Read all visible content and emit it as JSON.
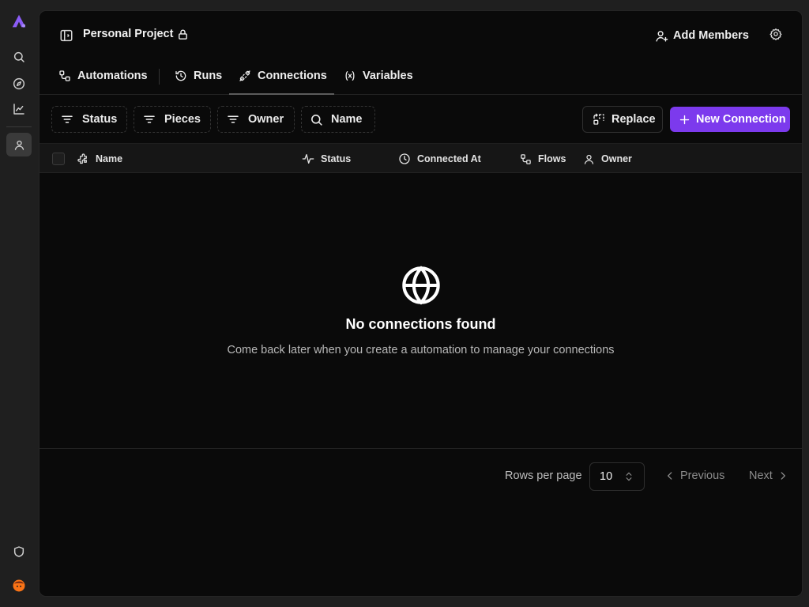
{
  "project": {
    "title": "Personal Project"
  },
  "header": {
    "add_members_label": "Add Members"
  },
  "tabs": [
    {
      "label": "Automations"
    },
    {
      "label": "Runs"
    },
    {
      "label": "Connections",
      "active": true
    },
    {
      "label": "Variables"
    }
  ],
  "filters": [
    {
      "label": "Status"
    },
    {
      "label": "Pieces"
    },
    {
      "label": "Owner"
    },
    {
      "label": "Name"
    }
  ],
  "actions": {
    "replace_label": "Replace",
    "new_connection_label": "New Connection"
  },
  "table": {
    "columns": [
      {
        "label": "Name"
      },
      {
        "label": "Status"
      },
      {
        "label": "Connected At"
      },
      {
        "label": "Flows"
      },
      {
        "label": "Owner"
      }
    ]
  },
  "empty_state": {
    "title": "No connections found",
    "subtitle": "Come back later when you create a automation to manage your connections"
  },
  "pagination": {
    "rows_per_page_label": "Rows per page",
    "rows_per_page_value": "10",
    "previous_label": "Previous",
    "next_label": "Next"
  },
  "colors": {
    "accent": "#7c3aed",
    "logo": "#8b5cf6",
    "avatar": "#f97316"
  }
}
